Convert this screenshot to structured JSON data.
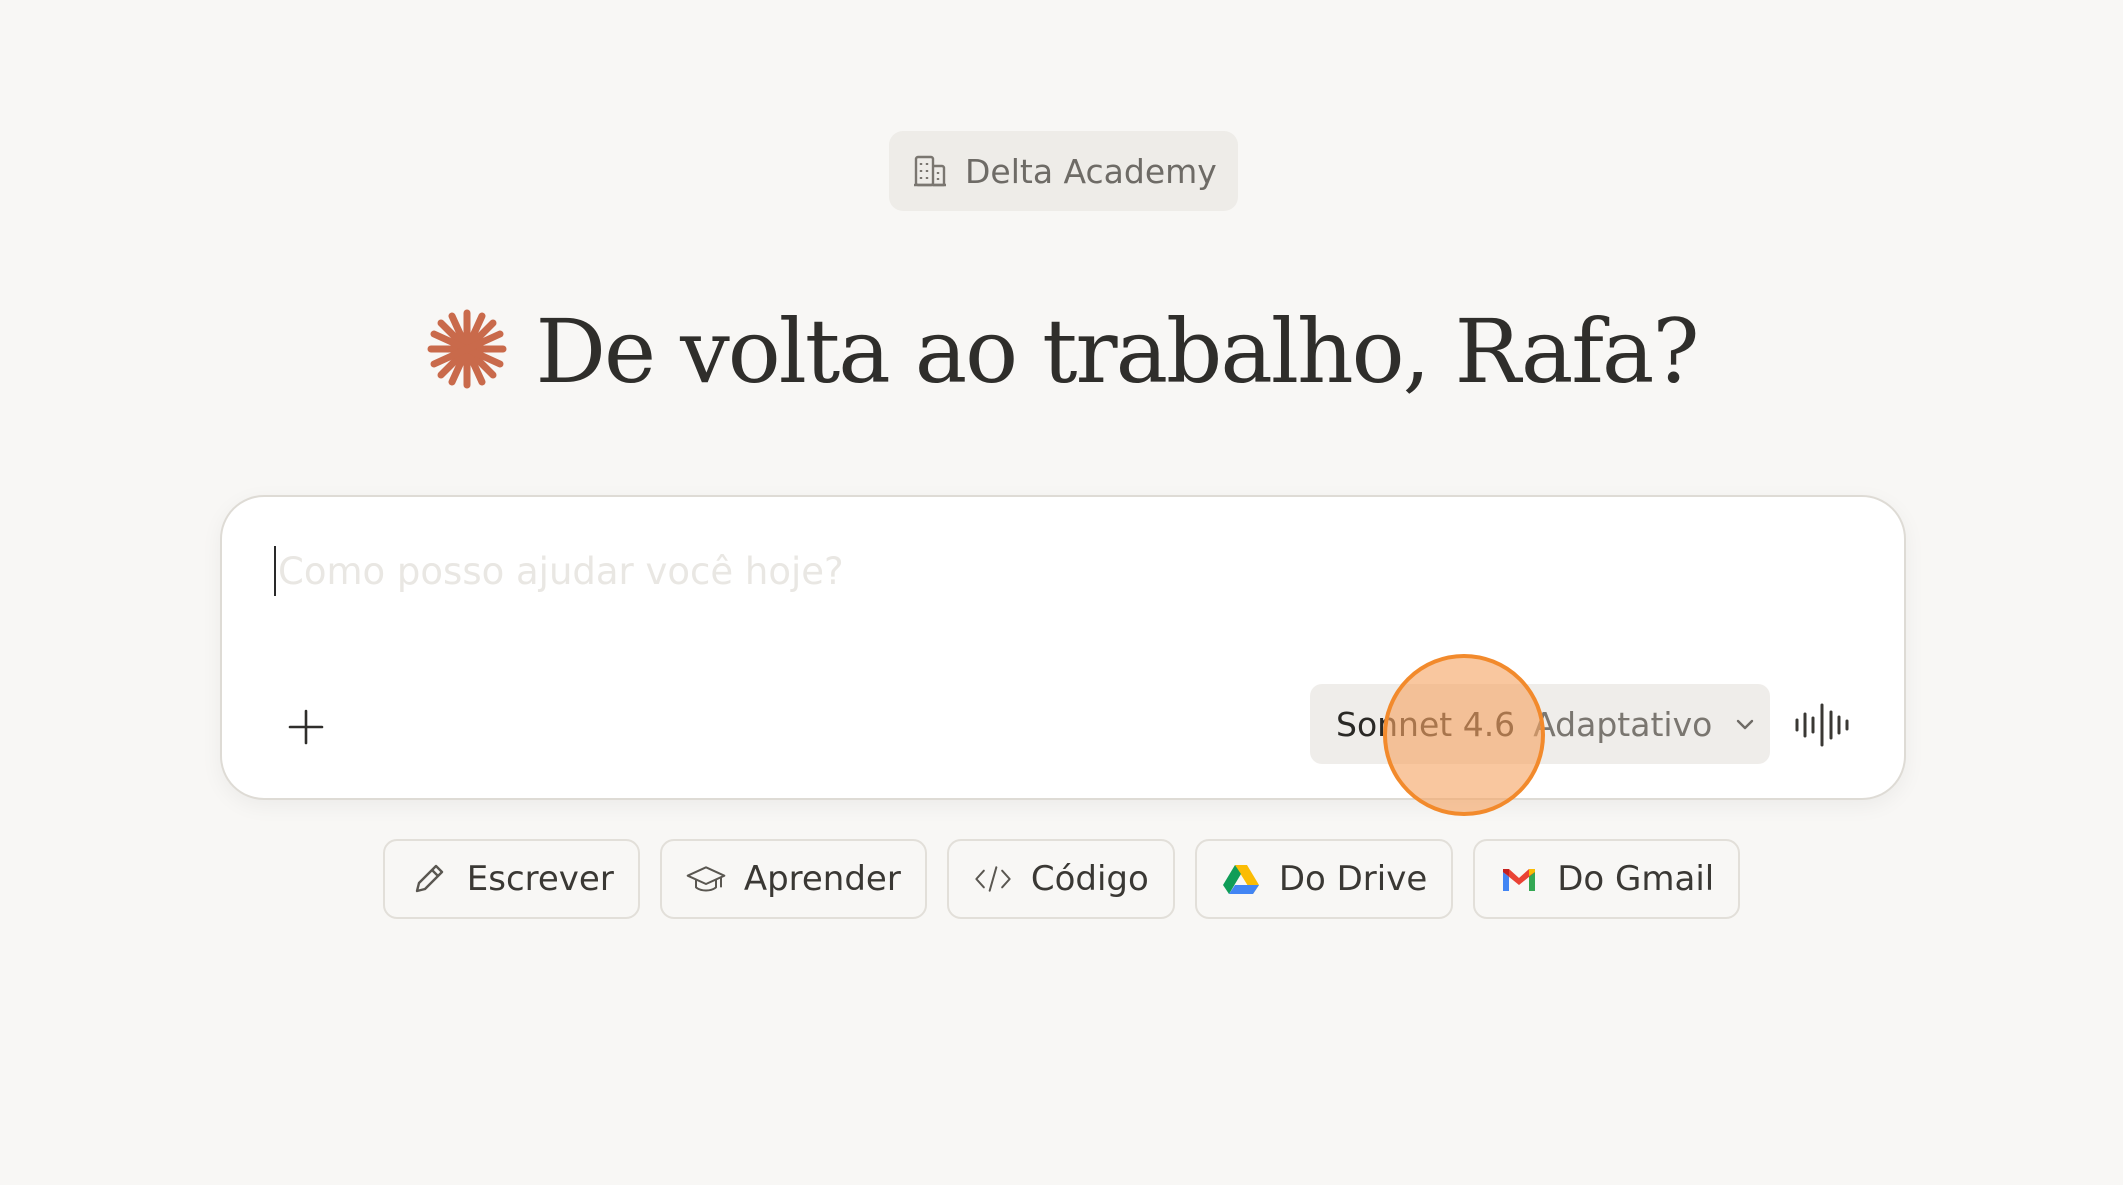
{
  "org": {
    "name": "Delta Academy",
    "icon": "building-icon"
  },
  "greeting": {
    "icon": "sparkle-icon",
    "text": "De volta ao trabalho, Rafa?",
    "accent_color": "#c96a4b"
  },
  "composer": {
    "placeholder": "Como posso ajudar você hoje?",
    "value": "",
    "attach_icon": "plus-icon",
    "model": {
      "name": "Sonnet 4.6",
      "mode": "Adaptativo",
      "icon": "chevron-down-icon"
    },
    "voice_icon": "voice-waveform-icon"
  },
  "suggestions": [
    {
      "label": "Escrever",
      "icon": "pencil-icon"
    },
    {
      "label": "Aprender",
      "icon": "graduation-cap-icon"
    },
    {
      "label": "Código",
      "icon": "code-icon"
    },
    {
      "label": "Do Drive",
      "icon": "google-drive-icon"
    },
    {
      "label": "Do Gmail",
      "icon": "gmail-icon"
    }
  ],
  "highlight_color": "#f28a2c"
}
